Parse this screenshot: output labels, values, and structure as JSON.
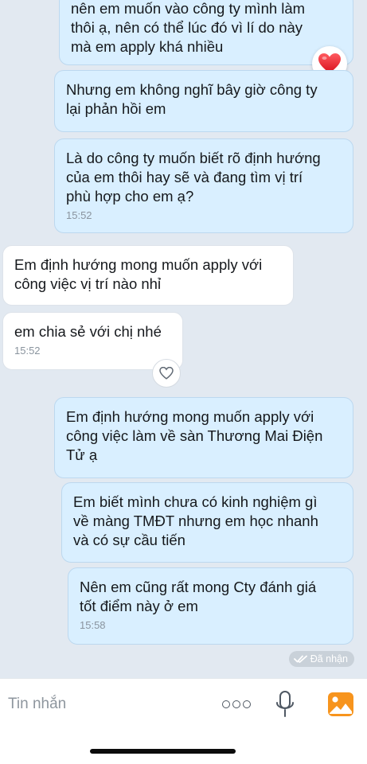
{
  "messages": [
    {
      "id": "m1",
      "side": "out",
      "text": "nên em muốn vào công ty mình làm\nthôi ạ, nên có thể lúc đó vì lí do này\nmà em apply khá nhiều",
      "time": ""
    },
    {
      "id": "m2",
      "side": "out",
      "text": "Nhưng em không nghĩ bây giờ công ty\nlại phản hồi em",
      "time": ""
    },
    {
      "id": "m3",
      "side": "out",
      "text": "Là do công ty muốn biết rõ định hướng\ncủa em thôi hay sẽ và đang tìm vị trí\nphù hợp cho em ạ?",
      "time": "15:52"
    },
    {
      "id": "m4",
      "side": "in",
      "text": "Em định hướng mong muốn apply với\ncông việc vị trí nào nhỉ",
      "time": ""
    },
    {
      "id": "m5",
      "side": "in",
      "text": "em chia sẻ với chị nhé",
      "time": "15:52"
    },
    {
      "id": "m6",
      "side": "out",
      "text": "Em định hướng mong muốn apply với\ncông việc làm về sàn Thương Mai Điện\nTử ạ",
      "time": ""
    },
    {
      "id": "m7",
      "side": "out",
      "text": "Em biết mình chưa có kinh nghiệm gì\nvề màng TMĐT nhưng em học nhanh\nvà có sự cầu tiến",
      "time": ""
    },
    {
      "id": "m8",
      "side": "out",
      "text": "Nên em cũng rất mong Cty đánh giá\ntốt điểm này ở em",
      "time": "15:58"
    }
  ],
  "reactions": {
    "heart": "red-heart-icon",
    "like": "heart-outline-icon"
  },
  "status": {
    "label": "Đã nhận",
    "icon": "double-check-icon"
  },
  "composer": {
    "placeholder": "Tin nhắn"
  },
  "colors": {
    "background": "#e2e9f1",
    "outgoing_bubble": "#d9efff",
    "incoming_bubble": "#ffffff",
    "image_icon_accent": "#f7941d",
    "heart": "#e8232e"
  }
}
